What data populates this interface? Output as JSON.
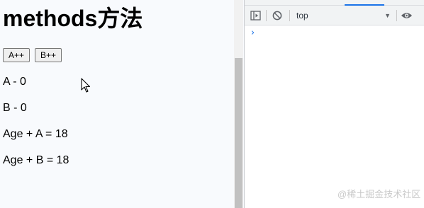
{
  "page": {
    "title": "methods方法",
    "buttons": {
      "a_label": "A++",
      "b_label": "B++"
    },
    "lines": {
      "a": "A - 0",
      "b": "B - 0",
      "age_a": "Age + A = 18",
      "age_b": "Age + B = 18"
    }
  },
  "devtools": {
    "context_label": "top",
    "context_arrow": "▼",
    "console_prompt": "›",
    "accent_color": "#1a73e8"
  },
  "icons": {
    "sidebar": "sidebar-toggle-icon",
    "clear": "clear-console-icon",
    "eye": "live-expression-eye-icon",
    "cursor": "mouse-pointer-icon"
  },
  "watermark": "@稀土掘金技术社区"
}
